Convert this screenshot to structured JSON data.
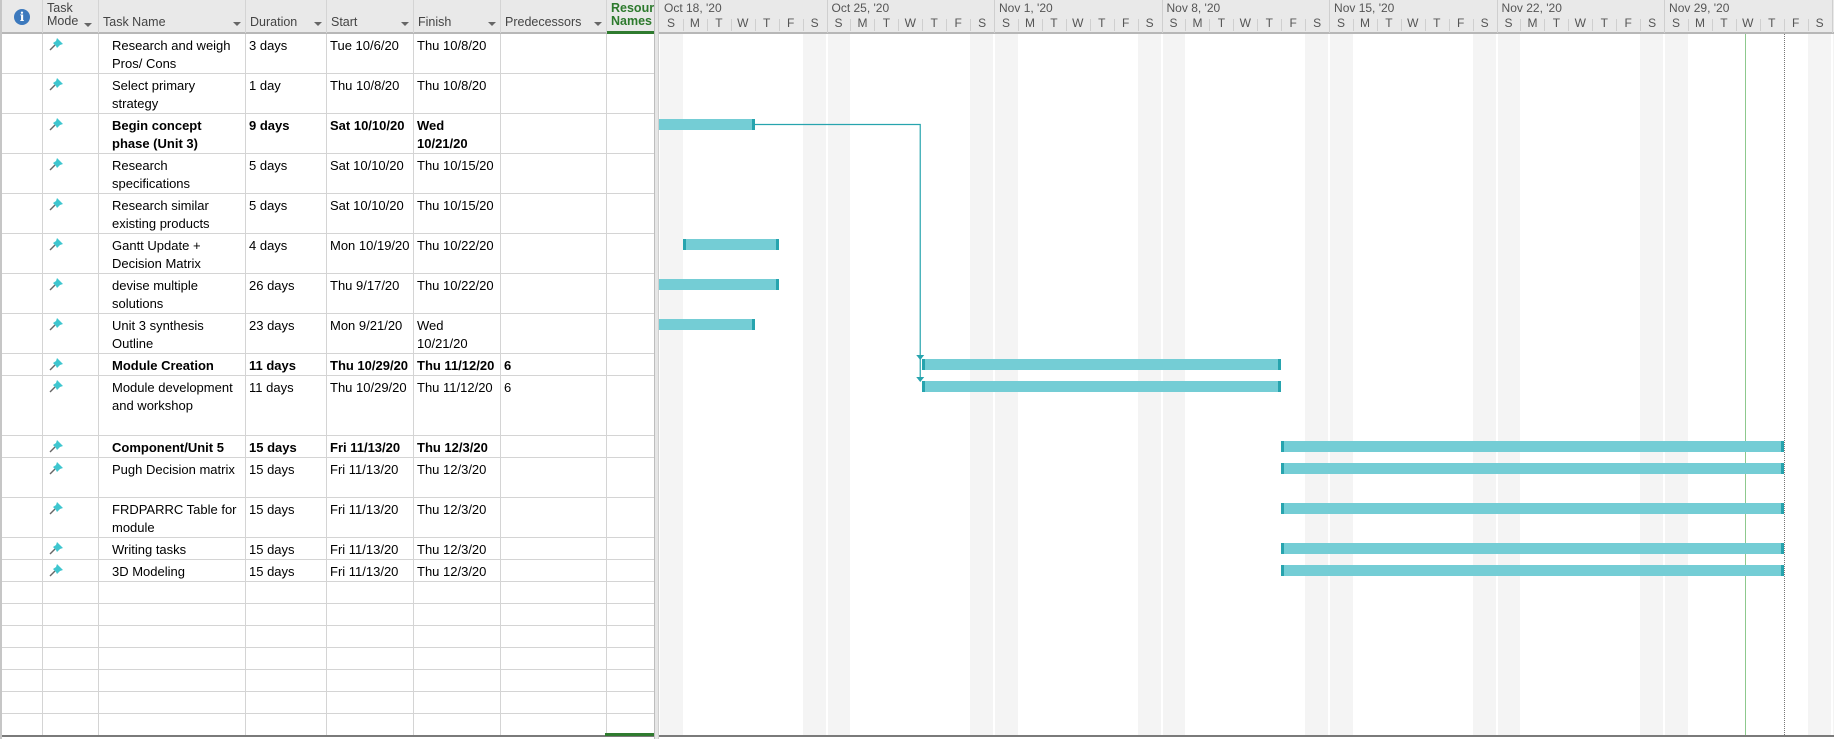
{
  "grid": {
    "columns": {
      "info": "i",
      "task_mode_line1": "Task",
      "task_mode_line2": "Mode",
      "task_name": "Task Name",
      "duration": "Duration",
      "start": "Start",
      "finish": "Finish",
      "predecessors": "Predecessors",
      "resource_line1": "Resourc",
      "resource_line2": "Names"
    },
    "rows": [
      {
        "name": "Research and weigh Pros/ Cons",
        "duration": "3 days",
        "start": "Tue 10/6/20",
        "finish": "Thu 10/8/20",
        "predecessors": "",
        "bold": false,
        "mode": "manually-scheduled-pin-icon"
      },
      {
        "name": "Select primary strategy",
        "duration": "1 day",
        "start": "Thu 10/8/20",
        "finish": "Thu 10/8/20",
        "predecessors": "",
        "bold": false,
        "mode": "manually-scheduled-pin-icon"
      },
      {
        "name": "Begin concept phase (Unit 3)",
        "duration": "9 days",
        "start": "Sat 10/10/20",
        "finish": "Wed 10/21/20",
        "predecessors": "",
        "bold": true,
        "mode": "manually-scheduled-pin-icon"
      },
      {
        "name": "Research specifications",
        "duration": "5 days",
        "start": "Sat 10/10/20",
        "finish": "Thu 10/15/20",
        "predecessors": "",
        "bold": false,
        "mode": "manually-scheduled-pin-icon"
      },
      {
        "name": "Research similar existing products",
        "duration": "5 days",
        "start": "Sat 10/10/20",
        "finish": "Thu 10/15/20",
        "predecessors": "",
        "bold": false,
        "mode": "manually-scheduled-pin-icon"
      },
      {
        "name": "Gantt Update + Decision Matrix",
        "duration": "4 days",
        "start": "Mon 10/19/20",
        "finish": "Thu 10/22/20",
        "predecessors": "",
        "bold": false,
        "mode": "manually-scheduled-pin-icon"
      },
      {
        "name": "devise multiple solutions",
        "duration": "26 days",
        "start": "Thu 9/17/20",
        "finish": "Thu 10/22/20",
        "predecessors": "",
        "bold": false,
        "mode": "manually-scheduled-pin-icon"
      },
      {
        "name": "Unit 3 synthesis Outline",
        "duration": "23 days",
        "start": "Mon 9/21/20",
        "finish": "Wed 10/21/20",
        "predecessors": "",
        "bold": false,
        "mode": "manually-scheduled-pin-icon"
      },
      {
        "name": "Module Creation",
        "duration": "11 days",
        "start": "Thu 10/29/20",
        "finish": "Thu 11/12/20",
        "predecessors": "6",
        "bold": true,
        "mode": "manually-scheduled-pin-icon"
      },
      {
        "name": "Module development and workshop",
        "duration": "11 days",
        "start": "Thu 10/29/20",
        "finish": "Thu 11/12/20",
        "predecessors": "6",
        "bold": false,
        "mode": "manually-scheduled-pin-icon"
      },
      {
        "name": "Component/Unit 5",
        "duration": "15 days",
        "start": "Fri 11/13/20",
        "finish": "Thu 12/3/20",
        "predecessors": "",
        "bold": true,
        "mode": "manually-scheduled-pin-icon"
      },
      {
        "name": "Pugh Decision matrix",
        "duration": "15 days",
        "start": "Fri 11/13/20",
        "finish": "Thu 12/3/20",
        "predecessors": "",
        "bold": false,
        "mode": "manually-scheduled-pin-icon"
      },
      {
        "name": "FRDPARRC Table for module",
        "duration": "15 days",
        "start": "Fri 11/13/20",
        "finish": "Thu 12/3/20",
        "predecessors": "",
        "bold": false,
        "mode": "manually-scheduled-pin-icon"
      },
      {
        "name": "Writing tasks",
        "duration": "15 days",
        "start": "Fri 11/13/20",
        "finish": "Thu 12/3/20",
        "predecessors": "",
        "bold": false,
        "mode": "manually-scheduled-pin-icon"
      },
      {
        "name": "3D Modeling",
        "duration": "15 days",
        "start": "Fri 11/13/20",
        "finish": "Thu 12/3/20",
        "predecessors": "",
        "bold": false,
        "mode": "manually-scheduled-pin-icon"
      }
    ],
    "empty_rows": 7
  },
  "timeline": {
    "weeks": [
      "Oct 18, '20",
      "Oct 25, '20",
      "Nov 1, '20",
      "Nov 8, '20",
      "Nov 15, '20",
      "Nov 22, '20",
      "Nov 29, '20"
    ],
    "day_letters": [
      "S",
      "M",
      "T",
      "W",
      "T",
      "F",
      "S"
    ],
    "visible_start_date": "2020-10-18",
    "today_date": "2020-12-02",
    "deadline_date": "2020-12-03",
    "bars": [
      {
        "row": 2,
        "start": "2020-10-10",
        "finish": "2020-10-21"
      },
      {
        "row": 5,
        "start": "2020-10-19",
        "finish": "2020-10-22"
      },
      {
        "row": 6,
        "start": "2020-09-17",
        "finish": "2020-10-22"
      },
      {
        "row": 7,
        "start": "2020-09-21",
        "finish": "2020-10-21"
      },
      {
        "row": 8,
        "start": "2020-10-29",
        "finish": "2020-11-12"
      },
      {
        "row": 9,
        "start": "2020-10-29",
        "finish": "2020-11-12"
      },
      {
        "row": 10,
        "start": "2020-11-13",
        "finish": "2020-12-03"
      },
      {
        "row": 11,
        "start": "2020-11-13",
        "finish": "2020-12-03"
      },
      {
        "row": 12,
        "start": "2020-11-13",
        "finish": "2020-12-03"
      },
      {
        "row": 13,
        "start": "2020-11-13",
        "finish": "2020-12-03"
      },
      {
        "row": 14,
        "start": "2020-11-13",
        "finish": "2020-12-03"
      }
    ],
    "links": [
      {
        "from_row": 2,
        "to_rows": [
          8,
          9
        ]
      }
    ]
  },
  "colors": {
    "bar": "#74cdd5",
    "bar_cap": "#27a4ae",
    "link": "#27a4ae",
    "pin": "#3fc6cf",
    "accent_green": "#2f7b2f",
    "today_line": "#8dc98d",
    "info_icon": "#3c79bd"
  }
}
